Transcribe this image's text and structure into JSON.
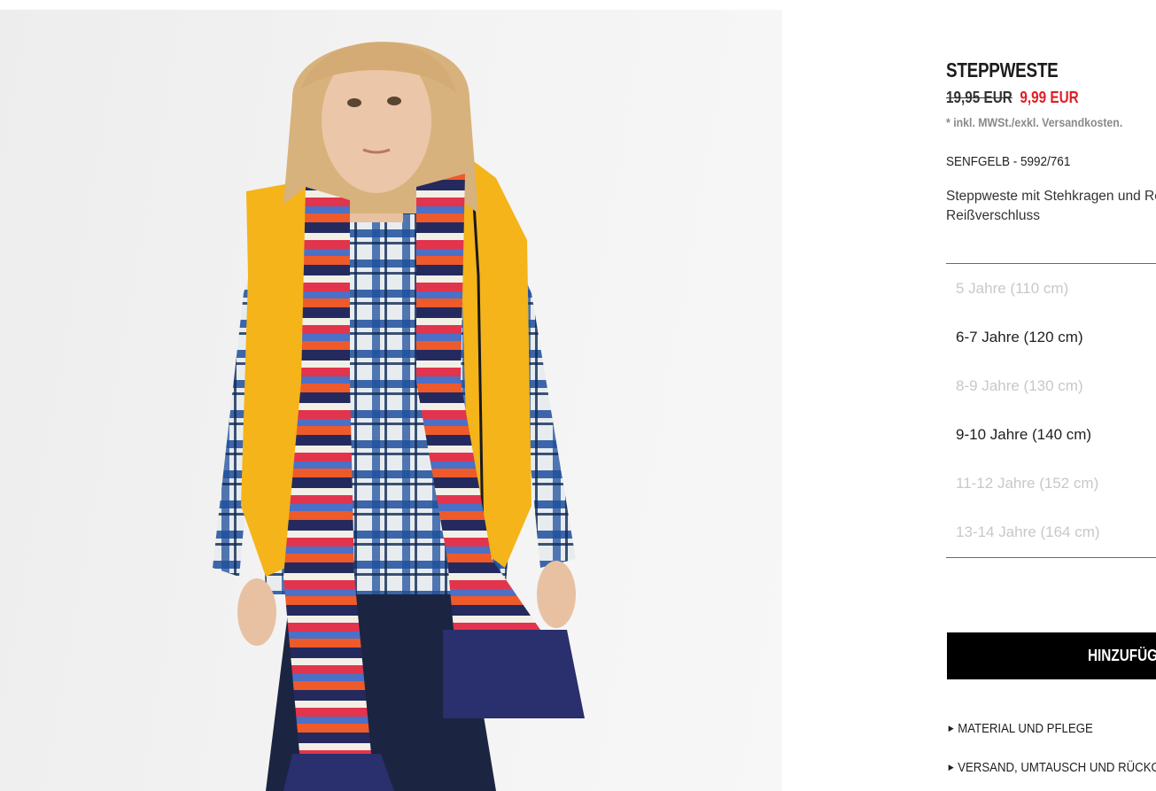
{
  "product": {
    "title": "STEPPWESTE",
    "old_price": "19,95 EUR",
    "sale_price": "9,99 EUR",
    "tax_note": "* inkl. MWSt./exkl. Versandkosten.",
    "color_ref": "SENFGELB - 5992/761",
    "description": "Steppweste mit Stehkragen und Reißverschluss vorn. Reißverschluss"
  },
  "sizes": [
    {
      "label": "5 Jahre (110 cm)",
      "available": false
    },
    {
      "label": "6-7 Jahre (120 cm)",
      "available": true
    },
    {
      "label": "8-9 Jahre (130 cm)",
      "available": false
    },
    {
      "label": "9-10 Jahre (140 cm)",
      "available": true
    },
    {
      "label": "11-12 Jahre (152 cm)",
      "available": false
    },
    {
      "label": "13-14 Jahre (164 cm)",
      "available": false
    }
  ],
  "actions": {
    "add_label": "HINZUFÜGEN"
  },
  "accordion": {
    "material": "MATERIAL UND PFLEGE",
    "shipping": "VERSAND, UMTAUSCH UND RÜCKGABE"
  },
  "colors": {
    "sale": "#e01e26",
    "button_bg": "#000000",
    "unavailable": "#c8c8c8",
    "vest": "#f4b41a"
  },
  "icons": {
    "accordion": "triangle-right-icon"
  }
}
